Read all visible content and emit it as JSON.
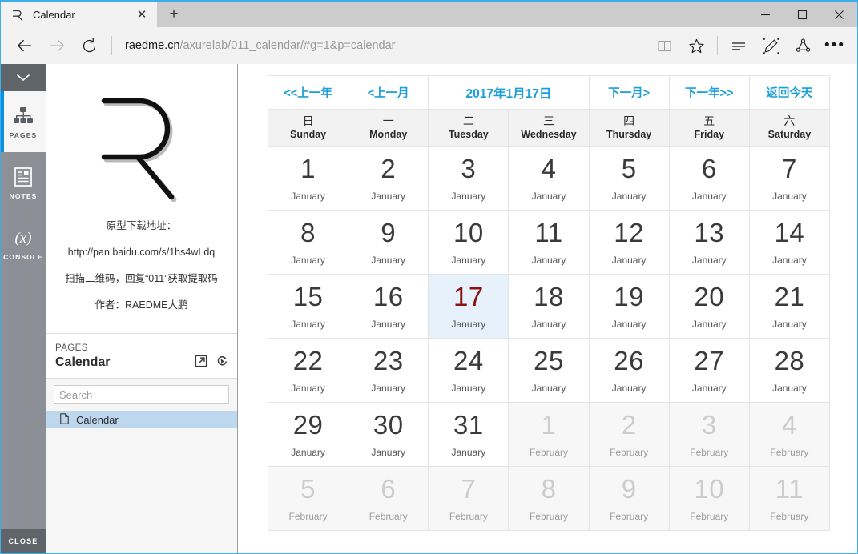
{
  "browser": {
    "tab": {
      "title": "Calendar",
      "favicon": "raedme-r-logo-icon",
      "close_label": "✕"
    },
    "newtab_label": "+",
    "window_controls": {
      "minimize": "—",
      "maximize": "□",
      "close": "✕"
    },
    "nav": {
      "back": "back-arrow-icon",
      "forward": "forward-arrow-icon",
      "refresh": "refresh-icon"
    },
    "address": {
      "host": "raedme.cn",
      "path": "/axurelab/011_calendar/#g=1&p=calendar",
      "full": "raedme.cn/axurelab/011_calendar/#g=1&p=calendar"
    },
    "tools": [
      "reading-view-icon",
      "favorites-star-icon",
      "hub-icon",
      "web-note-icon",
      "share-icon",
      "more-icon"
    ],
    "more_label": "•••"
  },
  "rail": {
    "collapse_label": "⌄",
    "items": [
      {
        "id": "pages",
        "label": "PAGES",
        "icon": "sitemap-icon",
        "active": true
      },
      {
        "id": "notes",
        "label": "NOTES",
        "icon": "notes-document-icon",
        "active": false
      },
      {
        "id": "console",
        "label": "CONSOLE",
        "icon": "console-fx-icon",
        "active": false
      }
    ],
    "close_label": "CLOSE"
  },
  "panel": {
    "brand": {
      "mark": "raedme-r-logo-icon",
      "lines": [
        "原型下载地址：",
        "http://pan.baidu.com/s/1hs4wLdq",
        "扫描二维码，回复“011”获取提取码",
        "作者：RAEDME大鹏"
      ]
    },
    "header": {
      "kicker": "PAGES",
      "title": "Calendar",
      "icons": [
        "open-in-new-window-icon",
        "interaction-pointer-icon"
      ]
    },
    "search": {
      "value": "",
      "placeholder": "Search"
    },
    "pages": [
      {
        "label": "Calendar",
        "icon": "page-document-icon",
        "selected": true
      }
    ]
  },
  "calendar": {
    "nav": {
      "prev_year": "<<上一年",
      "prev_month": "<上一月",
      "current_date": "2017年1月17日",
      "next_month": "下一月>",
      "next_year": "下一年>>",
      "today": "返回今天"
    },
    "weekdays": [
      {
        "cn": "日",
        "en": "Sunday"
      },
      {
        "cn": "一",
        "en": "Monday"
      },
      {
        "cn": "二",
        "en": "Tuesday"
      },
      {
        "cn": "三",
        "en": "Wednesday"
      },
      {
        "cn": "四",
        "en": "Thursday"
      },
      {
        "cn": "五",
        "en": "Friday"
      },
      {
        "cn": "六",
        "en": "Saturday"
      }
    ],
    "accent_color": "#1b9fd8",
    "today_bg": "#e6f1fb",
    "today_fg": "#8c1010",
    "weeks": [
      [
        {
          "day": "1",
          "month": "January",
          "out": false,
          "today": false
        },
        {
          "day": "2",
          "month": "January",
          "out": false,
          "today": false
        },
        {
          "day": "3",
          "month": "January",
          "out": false,
          "today": false
        },
        {
          "day": "4",
          "month": "January",
          "out": false,
          "today": false
        },
        {
          "day": "5",
          "month": "January",
          "out": false,
          "today": false
        },
        {
          "day": "6",
          "month": "January",
          "out": false,
          "today": false
        },
        {
          "day": "7",
          "month": "January",
          "out": false,
          "today": false
        }
      ],
      [
        {
          "day": "8",
          "month": "January",
          "out": false,
          "today": false
        },
        {
          "day": "9",
          "month": "January",
          "out": false,
          "today": false
        },
        {
          "day": "10",
          "month": "January",
          "out": false,
          "today": false
        },
        {
          "day": "11",
          "month": "January",
          "out": false,
          "today": false
        },
        {
          "day": "12",
          "month": "January",
          "out": false,
          "today": false
        },
        {
          "day": "13",
          "month": "January",
          "out": false,
          "today": false
        },
        {
          "day": "14",
          "month": "January",
          "out": false,
          "today": false
        }
      ],
      [
        {
          "day": "15",
          "month": "January",
          "out": false,
          "today": false
        },
        {
          "day": "16",
          "month": "January",
          "out": false,
          "today": false
        },
        {
          "day": "17",
          "month": "January",
          "out": false,
          "today": true
        },
        {
          "day": "18",
          "month": "January",
          "out": false,
          "today": false
        },
        {
          "day": "19",
          "month": "January",
          "out": false,
          "today": false
        },
        {
          "day": "20",
          "month": "January",
          "out": false,
          "today": false
        },
        {
          "day": "21",
          "month": "January",
          "out": false,
          "today": false
        }
      ],
      [
        {
          "day": "22",
          "month": "January",
          "out": false,
          "today": false
        },
        {
          "day": "23",
          "month": "January",
          "out": false,
          "today": false
        },
        {
          "day": "24",
          "month": "January",
          "out": false,
          "today": false
        },
        {
          "day": "25",
          "month": "January",
          "out": false,
          "today": false
        },
        {
          "day": "26",
          "month": "January",
          "out": false,
          "today": false
        },
        {
          "day": "27",
          "month": "January",
          "out": false,
          "today": false
        },
        {
          "day": "28",
          "month": "January",
          "out": false,
          "today": false
        }
      ],
      [
        {
          "day": "29",
          "month": "January",
          "out": false,
          "today": false
        },
        {
          "day": "30",
          "month": "January",
          "out": false,
          "today": false
        },
        {
          "day": "31",
          "month": "January",
          "out": false,
          "today": false
        },
        {
          "day": "1",
          "month": "February",
          "out": true,
          "today": false
        },
        {
          "day": "2",
          "month": "February",
          "out": true,
          "today": false
        },
        {
          "day": "3",
          "month": "February",
          "out": true,
          "today": false
        },
        {
          "day": "4",
          "month": "February",
          "out": true,
          "today": false
        }
      ],
      [
        {
          "day": "5",
          "month": "February",
          "out": true,
          "today": false
        },
        {
          "day": "6",
          "month": "February",
          "out": true,
          "today": false
        },
        {
          "day": "7",
          "month": "February",
          "out": true,
          "today": false
        },
        {
          "day": "8",
          "month": "February",
          "out": true,
          "today": false
        },
        {
          "day": "9",
          "month": "February",
          "out": true,
          "today": false
        },
        {
          "day": "10",
          "month": "February",
          "out": true,
          "today": false
        },
        {
          "day": "11",
          "month": "February",
          "out": true,
          "today": false
        }
      ]
    ]
  }
}
